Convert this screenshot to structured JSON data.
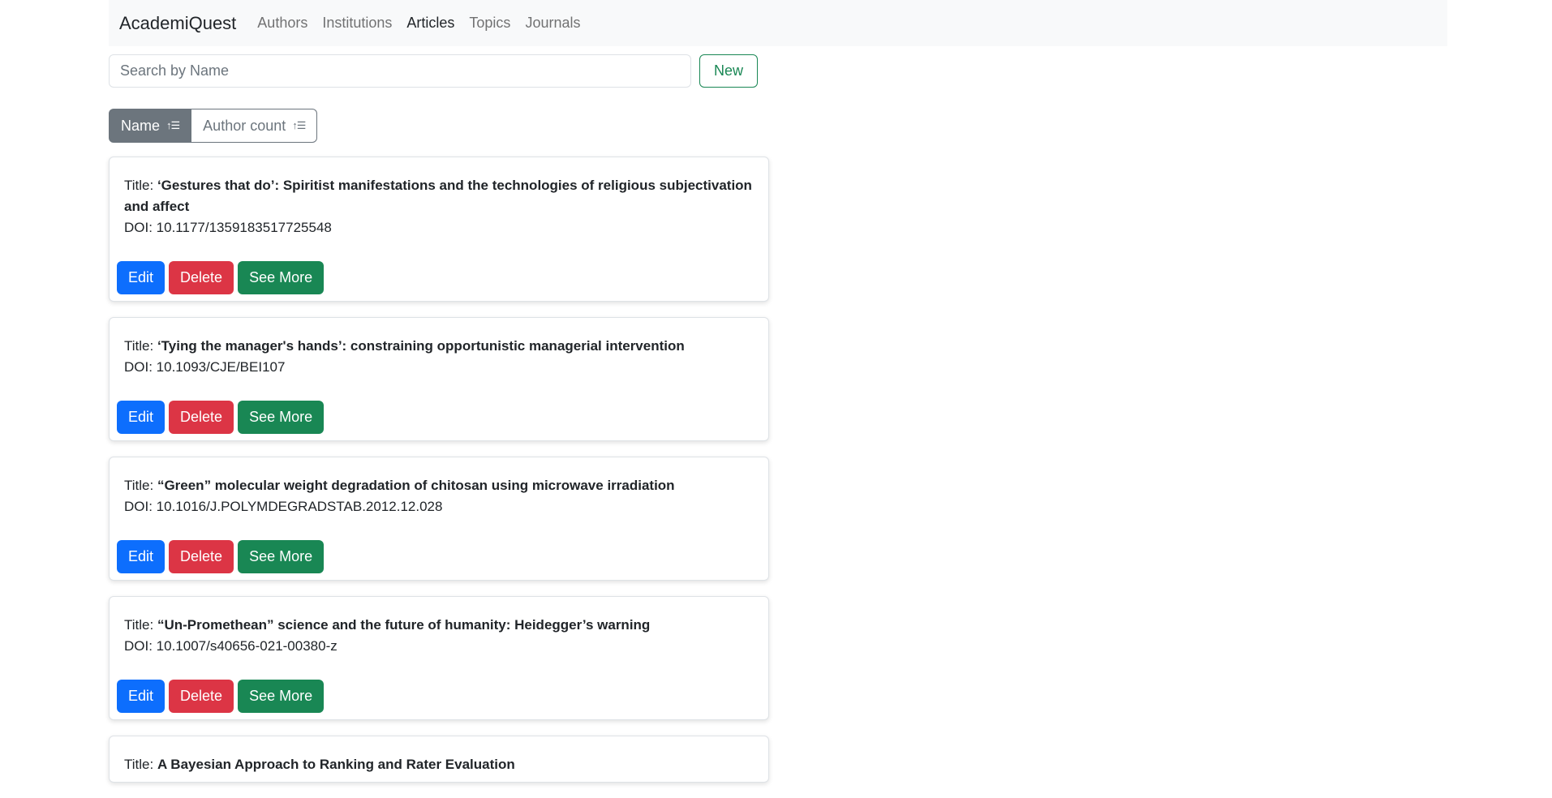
{
  "navbar": {
    "brand": "AcademiQuest",
    "links": [
      "Authors",
      "Institutions",
      "Articles",
      "Topics",
      "Journals"
    ]
  },
  "search": {
    "placeholder": "Search by Name",
    "new_label": "New"
  },
  "sort": {
    "name_label": "Name",
    "author_count_label": "Author count"
  },
  "cards": {
    "title_prefix": "Title: ",
    "doi_prefix": "DOI: ",
    "edit_label": "Edit",
    "delete_label": "Delete",
    "more_label": "See More",
    "items": [
      {
        "title": "‘Gestures that do’: Spiritist manifestations and the technologies of religious subjectivation and affect",
        "doi": "10.1177/1359183517725548"
      },
      {
        "title": "‘Tying the manager's hands’: constraining opportunistic managerial intervention",
        "doi": "10.1093/CJE/BEI107"
      },
      {
        "title": "“Green” molecular weight degradation of chitosan using microwave irradiation",
        "doi": "10.1016/J.POLYMDEGRADSTAB.2012.12.028"
      },
      {
        "title": "“Un-Promethean” science and the future of humanity: Heidegger’s warning",
        "doi": "10.1007/s40656-021-00380-z"
      },
      {
        "title": "A Bayesian Approach to Ranking and Rater Evaluation",
        "doi": ""
      }
    ]
  },
  "colors": {
    "primary": "#0d6efd",
    "danger": "#dc3545",
    "success": "#198754",
    "secondary": "#6c757d"
  }
}
